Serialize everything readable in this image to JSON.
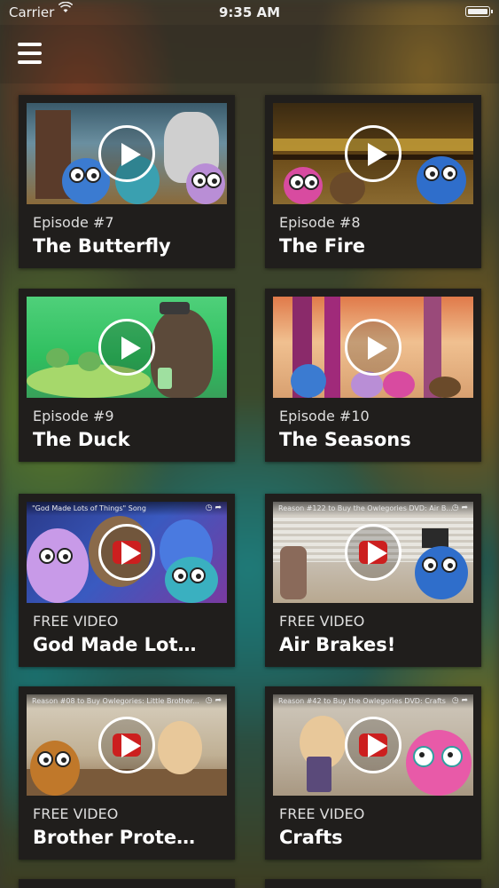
{
  "status_bar": {
    "carrier": "Carrier",
    "time": "9:35 AM",
    "wifi_icon": "wifi-icon",
    "battery_icon": "battery-icon"
  },
  "header": {
    "menu_icon": "hamburger-menu-icon"
  },
  "cards": [
    {
      "episode": "Episode #7",
      "title": "The Butterfly",
      "thumbnail_caption": ""
    },
    {
      "episode": "Episode #8",
      "title": "The Fire",
      "thumbnail_caption": ""
    },
    {
      "episode": "Episode #9",
      "title": "The Duck",
      "thumbnail_caption": ""
    },
    {
      "episode": "Episode #10",
      "title": "The Seasons",
      "thumbnail_caption": ""
    },
    {
      "episode": "FREE VIDEO",
      "title": "God Made Lot…",
      "thumbnail_caption": "\"God Made Lots of Things\" Song"
    },
    {
      "episode": "FREE VIDEO",
      "title": "Air Brakes!",
      "thumbnail_caption": "Reason #122 to Buy the Owlegories DVD: Air B..."
    },
    {
      "episode": "FREE VIDEO",
      "title": "Brother Prote…",
      "thumbnail_caption": "Reason #08 to Buy Owlegories: Little Brother..."
    },
    {
      "episode": "FREE VIDEO",
      "title": "Crafts",
      "thumbnail_caption": "Reason #42 to Buy the Owlegories DVD: Crafts"
    }
  ],
  "colors": {
    "card_background": "#201e1c",
    "text_primary": "#ffffff",
    "text_secondary": "#dedede",
    "play_icon": "#ffffff",
    "youtube_red": "#cc1f1f"
  }
}
